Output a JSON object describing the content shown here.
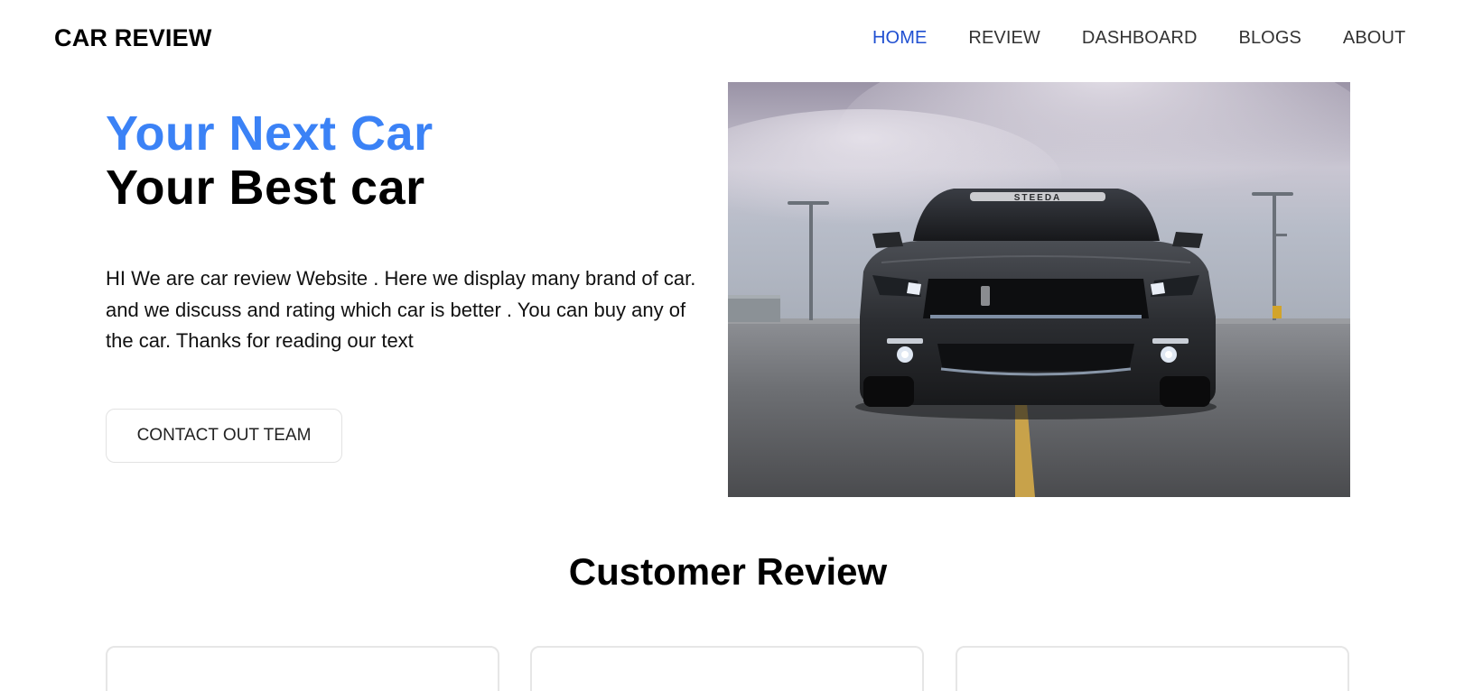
{
  "header": {
    "brand": "CAR REVIEW",
    "nav": [
      "HOME",
      "REVIEW",
      "DASHBOARD",
      "BLOGS",
      "ABOUT"
    ],
    "active": "HOME"
  },
  "hero": {
    "title_line1": "Your Next Car",
    "title_line2": "Your Best car",
    "description": "HI We are car review Website . Here we display many brand of car. and we discuss and rating which car is better . You can buy any of the car. Thanks for reading our text",
    "cta_label": "CONTACT OUT TEAM",
    "image_windshield_text": "STEEDA"
  },
  "reviews": {
    "title": "Customer Review"
  },
  "colors": {
    "accent": "#3b82f6",
    "nav_active": "#1f4fd1"
  }
}
